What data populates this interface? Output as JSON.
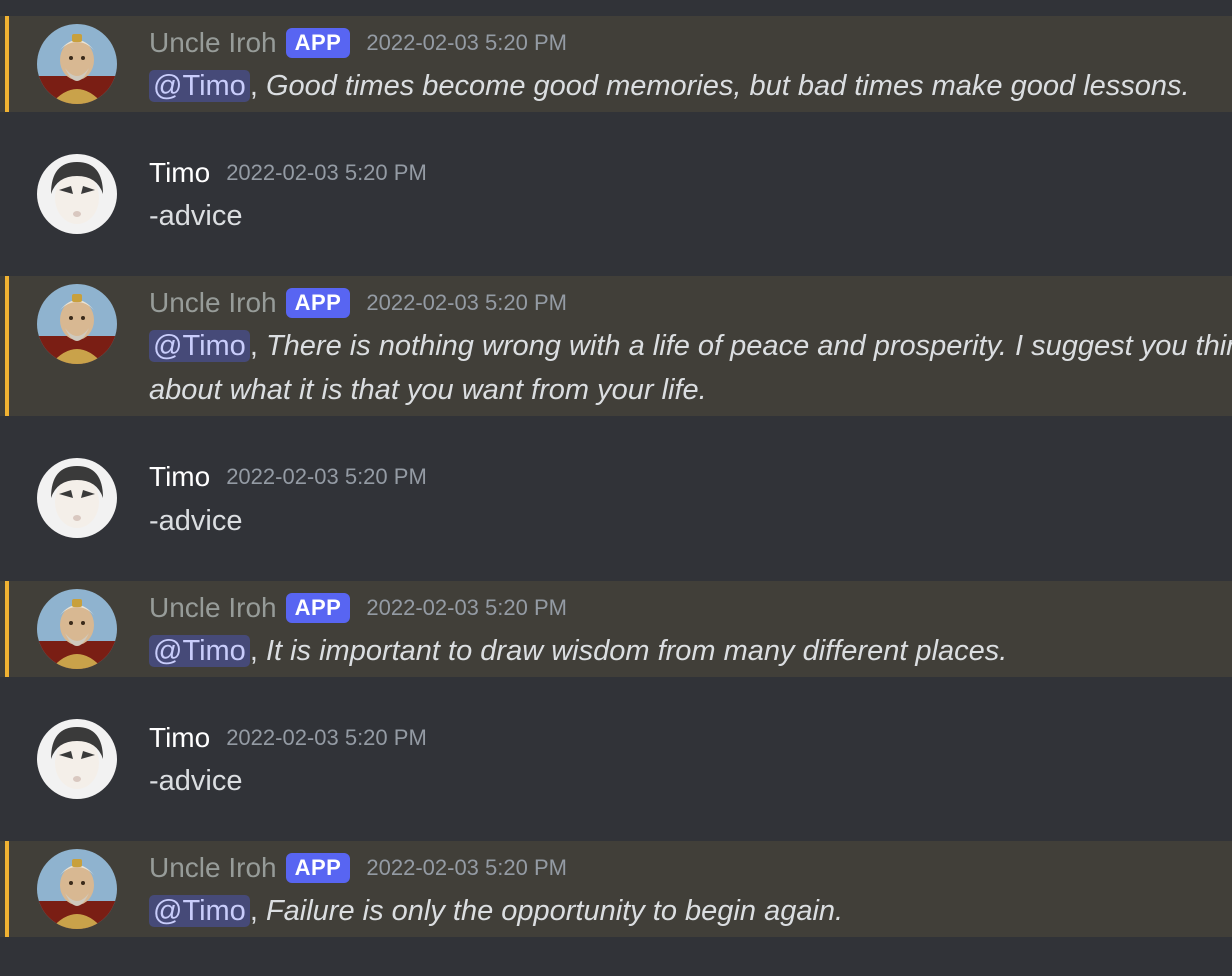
{
  "messages": [
    {
      "author": "Uncle Iroh",
      "badge": "APP",
      "timestamp": "2022-02-03 5:20 PM",
      "mention": "@Timo",
      "separator": ",",
      "text": "Good times become good memories, but bad times make good lessons."
    },
    {
      "author": "Timo",
      "timestamp": "2022-02-03 5:20 PM",
      "text": "-advice"
    },
    {
      "author": "Uncle Iroh",
      "badge": "APP",
      "timestamp": "2022-02-03 5:20 PM",
      "mention": "@Timo",
      "separator": ",",
      "text": "There is nothing wrong with a life of peace and prosperity. I suggest you think about what it is that you want from your life."
    },
    {
      "author": "Timo",
      "timestamp": "2022-02-03 5:20 PM",
      "text": "-advice"
    },
    {
      "author": "Uncle Iroh",
      "badge": "APP",
      "timestamp": "2022-02-03 5:20 PM",
      "mention": "@Timo",
      "separator": ",",
      "text": "It is important to draw wisdom from many different places."
    },
    {
      "author": "Timo",
      "timestamp": "2022-02-03 5:20 PM",
      "text": "-advice"
    },
    {
      "author": "Uncle Iroh",
      "badge": "APP",
      "timestamp": "2022-02-03 5:20 PM",
      "mention": "@Timo",
      "separator": ",",
      "text": "Failure is only the opportunity to begin again."
    }
  ],
  "colors": {
    "background": "#313338",
    "mention_highlight": "#413f39",
    "mention_bar": "#f0b232",
    "app_badge": "#5865f2",
    "mention_pill": "#464a78"
  },
  "icons": {
    "bot_avatar": "uncle-iroh-avatar",
    "user_avatar": "timo-avatar"
  }
}
